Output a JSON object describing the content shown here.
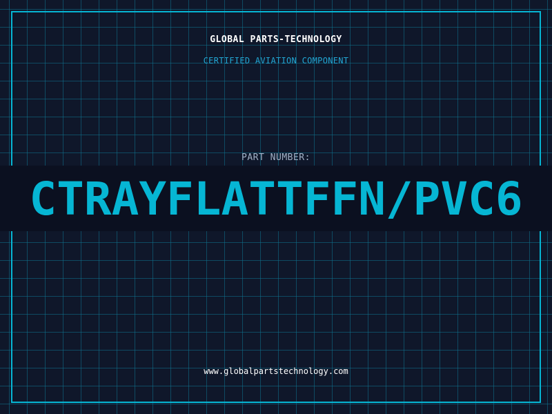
{
  "header": {
    "company": "GLOBAL PARTS-TECHNOLOGY",
    "subtitle": "CERTIFIED AVIATION COMPONENT"
  },
  "part": {
    "label": "PART NUMBER:",
    "number": "CTRAYFLATTFFN/PVC6"
  },
  "footer": {
    "website": "www.globalpartstechnology.com"
  },
  "colors": {
    "background": "#0f172a",
    "grid": "#0e7490",
    "accent": "#06b6d4",
    "label": "#a3b1c6",
    "text": "#ffffff"
  }
}
